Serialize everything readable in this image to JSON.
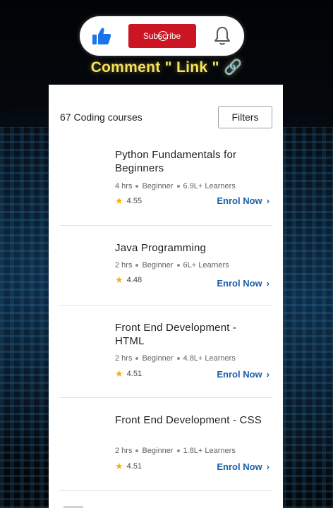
{
  "overlay": {
    "subscribe_label": "Subscribe",
    "like_icon": "thumbs-up-icon",
    "bell_icon": "bell-icon",
    "comment_text": "Comment \" Link \"",
    "link_icon": "🔗",
    "colors": {
      "subscribe": "#cc1522",
      "like": "#1a73e8",
      "comment": "#f7e15a"
    }
  },
  "header": {
    "count_text": "67 Coding courses",
    "filters_label": "Filters"
  },
  "courses": [
    {
      "title": "Python Fundamentals for Beginners",
      "duration": "4 hrs",
      "level": "Beginner",
      "learners": "6.9L+ Learners",
      "rating": "4.55",
      "cta": "Enrol Now"
    },
    {
      "title": "Java Programming",
      "duration": "2 hrs",
      "level": "Beginner",
      "learners": "6L+ Learners",
      "rating": "4.48",
      "cta": "Enrol Now"
    },
    {
      "title": "Front End Development - HTML",
      "duration": "2 hrs",
      "level": "Beginner",
      "learners": "4.8L+ Learners",
      "rating": "4.51",
      "cta": "Enrol Now"
    },
    {
      "title": "Front End Development - CSS",
      "duration": "2 hrs",
      "level": "Beginner",
      "learners": "1.8L+ Learners",
      "rating": "4.51",
      "cta": "Enrol Now"
    }
  ]
}
